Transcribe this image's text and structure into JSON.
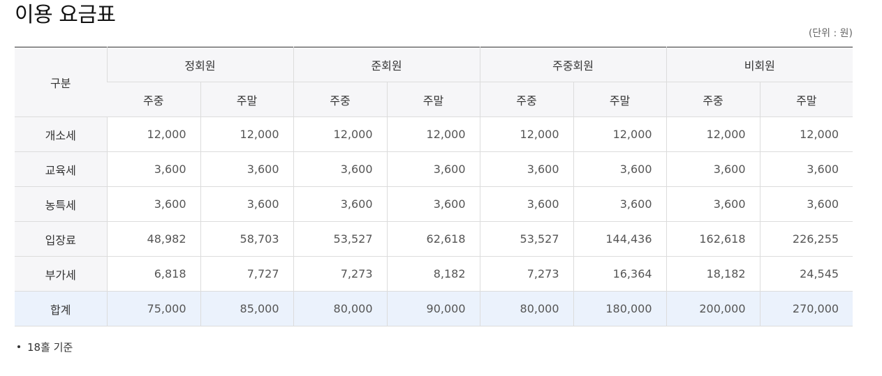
{
  "page": {
    "title": "이용 요금표",
    "unit": "(단위 : 원)",
    "note": "18홀 기준"
  },
  "table": {
    "category_header": "구분",
    "groups": [
      "정회원",
      "준회원",
      "주중회원",
      "비회원"
    ],
    "sub_headers": [
      "주중",
      "주말",
      "주중",
      "주말",
      "주중",
      "주말",
      "주중",
      "주말"
    ],
    "rows": [
      {
        "label": "개소세",
        "values": [
          "12,000",
          "12,000",
          "12,000",
          "12,000",
          "12,000",
          "12,000",
          "12,000",
          "12,000"
        ]
      },
      {
        "label": "교육세",
        "values": [
          "3,600",
          "3,600",
          "3,600",
          "3,600",
          "3,600",
          "3,600",
          "3,600",
          "3,600"
        ]
      },
      {
        "label": "농특세",
        "values": [
          "3,600",
          "3,600",
          "3,600",
          "3,600",
          "3,600",
          "3,600",
          "3,600",
          "3,600"
        ]
      },
      {
        "label": "입장료",
        "values": [
          "48,982",
          "58,703",
          "53,527",
          "62,618",
          "53,527",
          "144,436",
          "162,618",
          "226,255"
        ]
      },
      {
        "label": "부가세",
        "values": [
          "6,818",
          "7,727",
          "7,273",
          "8,182",
          "7,273",
          "16,364",
          "18,182",
          "24,545"
        ]
      },
      {
        "label": "합계",
        "values": [
          "75,000",
          "85,000",
          "80,000",
          "90,000",
          "80,000",
          "180,000",
          "200,000",
          "270,000"
        ]
      }
    ]
  },
  "colors": {
    "header_bg": "#f6f6f8",
    "total_row_bg": "#ebf2fc",
    "border": "#dcdcdc",
    "top_rule": "#333333"
  }
}
